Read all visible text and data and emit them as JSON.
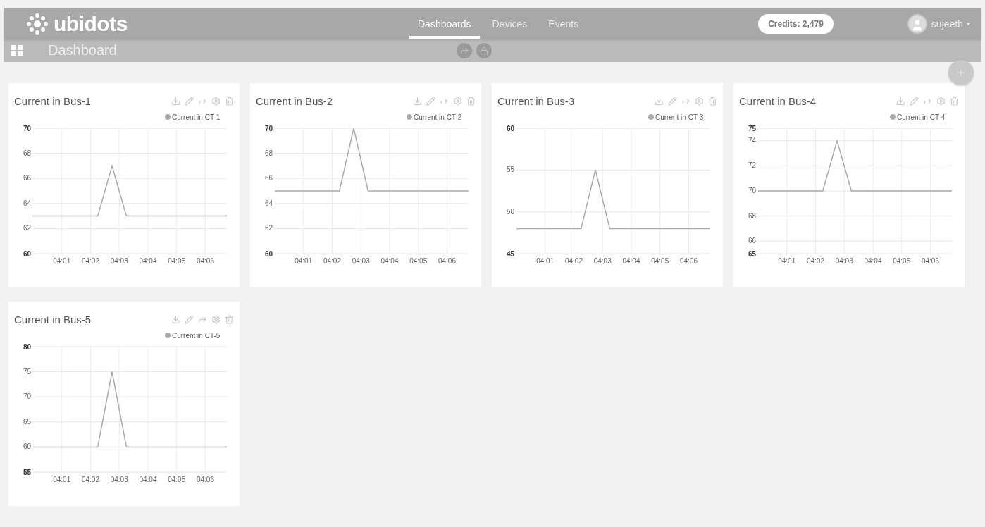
{
  "nav": {
    "logo": "ubidots",
    "tabs": [
      {
        "label": "Dashboards",
        "selected": true
      },
      {
        "label": "Devices",
        "selected": false
      },
      {
        "label": "Events",
        "selected": false
      }
    ],
    "credits": "Credits: 2,479",
    "user": "sujeeth"
  },
  "header": {
    "title": "Dashboard"
  },
  "widgets": [
    {
      "title": "Current in Bus-1",
      "chart_data": {
        "type": "line",
        "categories": [
          null,
          null,
          null,
          null,
          "04:01",
          null,
          null,
          null,
          "04:02",
          null,
          null,
          null,
          "04:03",
          null,
          null,
          null,
          "04:04",
          null,
          null,
          null,
          "04:05",
          null,
          null,
          null,
          "04:06",
          null,
          null,
          null
        ],
        "series": [
          {
            "name": "Current in CT-1",
            "color": "#aaaaaa",
            "values": [
              63,
              63,
              63,
              63,
              63,
              63,
              63,
              63,
              63,
              63,
              65,
              67,
              65,
              63,
              63,
              63,
              63,
              63,
              63,
              63,
              63,
              63,
              63,
              63,
              63,
              63,
              63,
              63
            ]
          }
        ],
        "ylim": [
          60,
          70
        ],
        "yticks": [
          60,
          62,
          64,
          66,
          68,
          70
        ],
        "grid": true
      }
    },
    {
      "title": "Current in Bus-2",
      "chart_data": {
        "type": "line",
        "categories": [
          null,
          null,
          null,
          null,
          "04:01",
          null,
          null,
          null,
          "04:02",
          null,
          null,
          null,
          "04:03",
          null,
          null,
          null,
          "04:04",
          null,
          null,
          null,
          "04:05",
          null,
          null,
          null,
          "04:06",
          null,
          null,
          null
        ],
        "series": [
          {
            "name": "Current in CT-2",
            "color": "#aaaaaa",
            "values": [
              65,
              65,
              65,
              65,
              65,
              65,
              65,
              65,
              65,
              65,
              67.5,
              70,
              67.5,
              65,
              65,
              65,
              65,
              65,
              65,
              65,
              65,
              65,
              65,
              65,
              65,
              65,
              65,
              65
            ]
          }
        ],
        "ylim": [
          60,
          70
        ],
        "yticks": [
          60,
          62,
          64,
          66,
          68,
          70
        ],
        "grid": true
      }
    },
    {
      "title": "Current in Bus-3",
      "chart_data": {
        "type": "line",
        "categories": [
          null,
          null,
          null,
          null,
          "04:01",
          null,
          null,
          null,
          "04:02",
          null,
          null,
          null,
          "04:03",
          null,
          null,
          null,
          "04:04",
          null,
          null,
          null,
          "04:05",
          null,
          null,
          null,
          "04:06",
          null,
          null,
          null
        ],
        "series": [
          {
            "name": "Current in CT-3",
            "color": "#aaaaaa",
            "values": [
              48,
              48,
              48,
              48,
              48,
              48,
              48,
              48,
              48,
              48,
              51.5,
              55,
              51.5,
              48,
              48,
              48,
              48,
              48,
              48,
              48,
              48,
              48,
              48,
              48,
              48,
              48,
              48,
              48
            ]
          }
        ],
        "ylim": [
          45,
          60
        ],
        "yticks": [
          45,
          50,
          55,
          60
        ],
        "grid": true
      }
    },
    {
      "title": "Current in Bus-4",
      "chart_data": {
        "type": "line",
        "categories": [
          null,
          null,
          null,
          null,
          "04:01",
          null,
          null,
          null,
          "04:02",
          null,
          null,
          null,
          "04:03",
          null,
          null,
          null,
          "04:04",
          null,
          null,
          null,
          "04:05",
          null,
          null,
          null,
          "04:06",
          null,
          null,
          null
        ],
        "series": [
          {
            "name": "Current in CT-4",
            "color": "#aaaaaa",
            "values": [
              70,
              70,
              70,
              70,
              70,
              70,
              70,
              70,
              70,
              70,
              72,
              74,
              72,
              70,
              70,
              70,
              70,
              70,
              70,
              70,
              70,
              70,
              70,
              70,
              70,
              70,
              70,
              70
            ]
          }
        ],
        "ylim": [
          65,
          75
        ],
        "yticks": [
          65,
          66,
          68,
          70,
          72,
          74,
          75
        ],
        "grid": true
      }
    },
    {
      "title": "Current in Bus-5",
      "chart_data": {
        "type": "line",
        "categories": [
          null,
          null,
          null,
          null,
          "04:01",
          null,
          null,
          null,
          "04:02",
          null,
          null,
          null,
          "04:03",
          null,
          null,
          null,
          "04:04",
          null,
          null,
          null,
          "04:05",
          null,
          null,
          null,
          "04:06",
          null,
          null,
          null
        ],
        "series": [
          {
            "name": "Current in CT-5",
            "color": "#aaaaaa",
            "values": [
              60,
              60,
              60,
              60,
              60,
              60,
              60,
              60,
              60,
              60,
              67.5,
              75,
              67.5,
              60,
              60,
              60,
              60,
              60,
              60,
              60,
              60,
              60,
              60,
              60,
              60,
              60,
              60,
              60
            ]
          }
        ],
        "ylim": [
          55,
          80
        ],
        "yticks": [
          55,
          60,
          65,
          70,
          75,
          80
        ],
        "grid": true
      }
    }
  ]
}
